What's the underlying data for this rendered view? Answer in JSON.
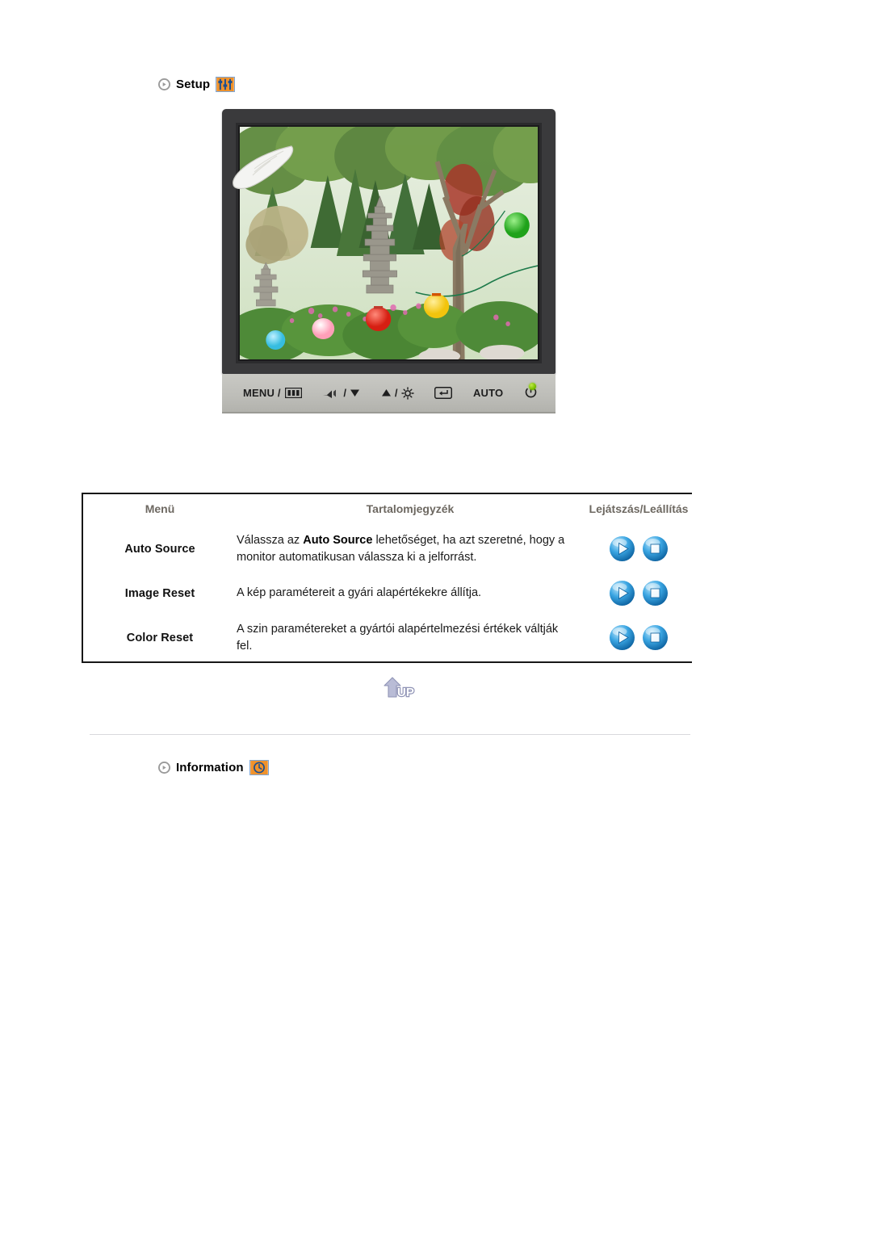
{
  "sections": {
    "setup": {
      "title": "Setup",
      "bullet_icon": "circle-arrow-bullet-icon",
      "badge_icon": "setup-sliders-icon",
      "badge_bg": "#f0922b",
      "badge_fg": "#1d4f8f"
    },
    "information": {
      "title": "Information",
      "bullet_icon": "circle-arrow-bullet-icon",
      "badge_icon": "information-clock-icon",
      "badge_bg": "#f0922b",
      "badge_fg": "#1d4f8f"
    }
  },
  "monitor": {
    "screen_alt": "Korean temple garden with stone pagoda and paper lanterns",
    "bezel_color": "#3a3a3c",
    "controls": [
      {
        "label": "MENU /",
        "icon": "menu-osd-icon"
      },
      {
        "label": "/",
        "icon": "volume-down-icon"
      },
      {
        "label": "/",
        "icon": "brightness-up-icon"
      },
      {
        "label": "",
        "icon": "enter-source-icon"
      },
      {
        "label": "AUTO",
        "icon": ""
      },
      {
        "label": "",
        "icon": "power-icon"
      }
    ],
    "led": {
      "name": "power-led",
      "color": "#7ec400"
    },
    "hand_icon": "pointing-hand-icon"
  },
  "table": {
    "headers": [
      "Menü",
      "Tartalomjegyzék",
      "Lejátszás/Leállítás"
    ],
    "rows": [
      {
        "menu": "Auto Source",
        "desc_pre": "Válassza az ",
        "desc_bold": "Auto Source",
        "desc_post": " lehetőséget, ha azt szeretné, hogy a monitor automatikusan válassza ki a jelforrást.",
        "play_label": "play-button",
        "stop_label": "stop-button"
      },
      {
        "menu": "Image Reset",
        "desc_pre": "A kép paramétereit a gyári alapértékekre állítja.",
        "desc_bold": "",
        "desc_post": "",
        "play_label": "play-button",
        "stop_label": "stop-button"
      },
      {
        "menu": "Color Reset",
        "desc_pre": "A szin paramétereket a gyártói alapértelmezési értékek váltják fel.",
        "desc_bold": "",
        "desc_post": "",
        "play_label": "play-button",
        "stop_label": "stop-button"
      }
    ]
  },
  "up_button": {
    "label": "UP",
    "icon": "up-arrow-icon"
  },
  "colors": {
    "header_text": "#6d6861",
    "body_text": "#1a1a1a",
    "table_border": "#171717",
    "divider": "#d9d9dd",
    "badge_orange": "#f0922b",
    "orb_blue": "#2e9fe0"
  }
}
